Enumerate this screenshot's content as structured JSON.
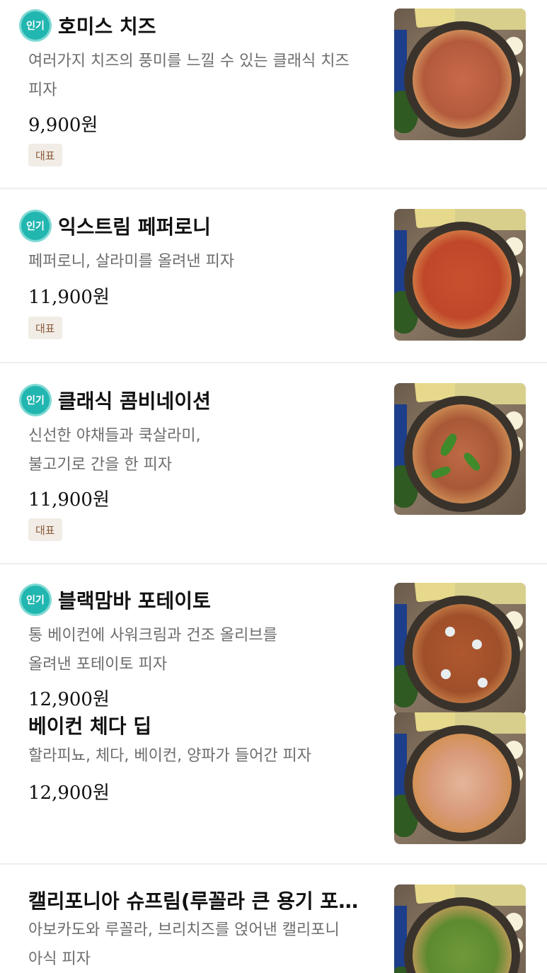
{
  "labels": {
    "popular_badge": "인기",
    "signature_tag": "대표"
  },
  "menu": [
    {
      "name": "호미스 치즈",
      "desc_lines": [
        "여러가지 치즈의 풍미를 느낄 수 있는 클래식 치즈",
        "피자"
      ],
      "price": "9,900원",
      "popular": true,
      "signature": true,
      "image_icon": "pizza-cheese-image"
    },
    {
      "name": "익스트림 페퍼로니",
      "desc_lines": [
        "페퍼로니, 살라미를 올려낸 피자"
      ],
      "price": "11,900원",
      "popular": true,
      "signature": true,
      "image_icon": "pizza-pepperoni-image"
    },
    {
      "name": "클래식 콤비네이션",
      "desc_lines": [
        "신선한 야채들과 쿡살라미,",
        "불고기로 간을 한 피자"
      ],
      "price": "11,900원",
      "popular": true,
      "signature": true,
      "image_icon": "pizza-combination-image"
    },
    {
      "name": "블랙맘바 포테이토",
      "desc_lines": [
        "통 베이컨에 사워크림과 건조 올리브를",
        "올려낸 포테이토 피자"
      ],
      "price": "12,900원",
      "popular": true,
      "signature": false,
      "image_icon": "pizza-potato-image"
    },
    {
      "name": "베이컨 체다 딥",
      "desc_lines": [
        "할라피뇨, 체다, 베이컨, 양파가 들어간 피자"
      ],
      "price": "12,900원",
      "popular": false,
      "signature": false,
      "image_icon": "pizza-bacon-image"
    },
    {
      "name": "캘리포니아 슈프림(루꼴라 큰 용기 포…",
      "desc_lines": [
        "아보카도와 루꼴라, 브리치즈를 얹어낸 캘리포니",
        "아식 피자"
      ],
      "price": "",
      "popular": false,
      "signature": false,
      "image_icon": "pizza-california-image"
    }
  ]
}
